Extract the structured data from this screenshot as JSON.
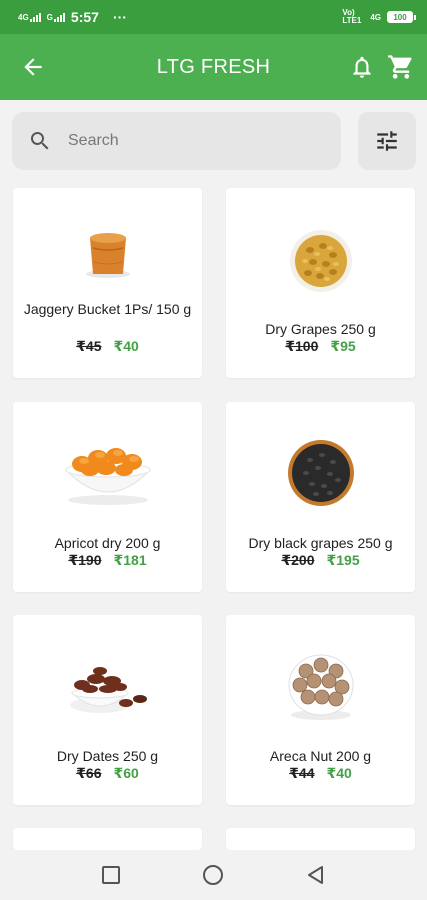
{
  "status": {
    "network1": "4G",
    "network2": "G",
    "time": "5:57",
    "dots": "···",
    "volte": "Vo) LTE1",
    "network3": "4G",
    "battery": "100"
  },
  "header": {
    "title": "LTG FRESH"
  },
  "search": {
    "placeholder": "Search"
  },
  "products": [
    {
      "name": "Jaggery Bucket 1Ps/ 150 g",
      "old_price": "₹45",
      "new_price": "₹40",
      "icon": "jaggery-bucket"
    },
    {
      "name": "Dry Grapes 250 g",
      "old_price": "₹100",
      "new_price": "₹95",
      "icon": "bowl-raisins"
    },
    {
      "name": "Apricot dry 200 g",
      "old_price": "₹190",
      "new_price": "₹181",
      "icon": "bowl-apricots"
    },
    {
      "name": "Dry black grapes 250 g",
      "old_price": "₹200",
      "new_price": "₹195",
      "icon": "bowl-black-grapes"
    },
    {
      "name": "Dry Dates 250 g",
      "old_price": "₹66",
      "new_price": "₹60",
      "icon": "bowl-dates"
    },
    {
      "name": "Areca Nut 200 g",
      "old_price": "₹44",
      "new_price": "₹40",
      "icon": "bowl-areca-nuts"
    }
  ],
  "colors": {
    "status_bar": "#3a9e3f",
    "app_bar": "#4caf50",
    "discount_price": "#43a047"
  }
}
